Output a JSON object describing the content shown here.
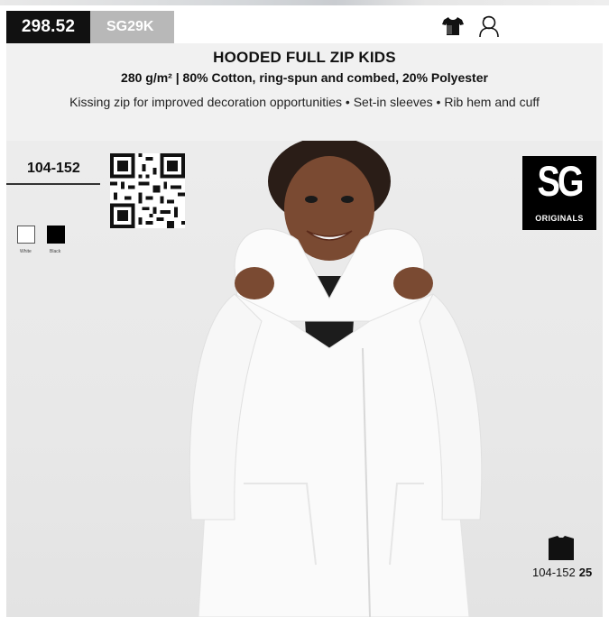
{
  "header": {
    "code": "298.52",
    "sku": "SG29K",
    "icons": [
      "tshirt-icon",
      "kid-icon"
    ]
  },
  "product": {
    "title": "HOODED FULL ZIP KIDS",
    "subtitle": "280 g/m² | 80% Cotton, ring-spun and combed, 20% Polyester",
    "features": "Kissing zip for improved decoration opportunities • Set-in sleeves • Rib hem and cuff"
  },
  "sizes": {
    "range": "104-152"
  },
  "colors": [
    {
      "name": "White",
      "hex": "#ffffff"
    },
    {
      "name": "Black",
      "hex": "#000000"
    }
  ],
  "brand": {
    "mark": "SG",
    "sub": "ORIGINALS"
  },
  "footer": {
    "fit_range": "104-152",
    "page_number": "25"
  }
}
